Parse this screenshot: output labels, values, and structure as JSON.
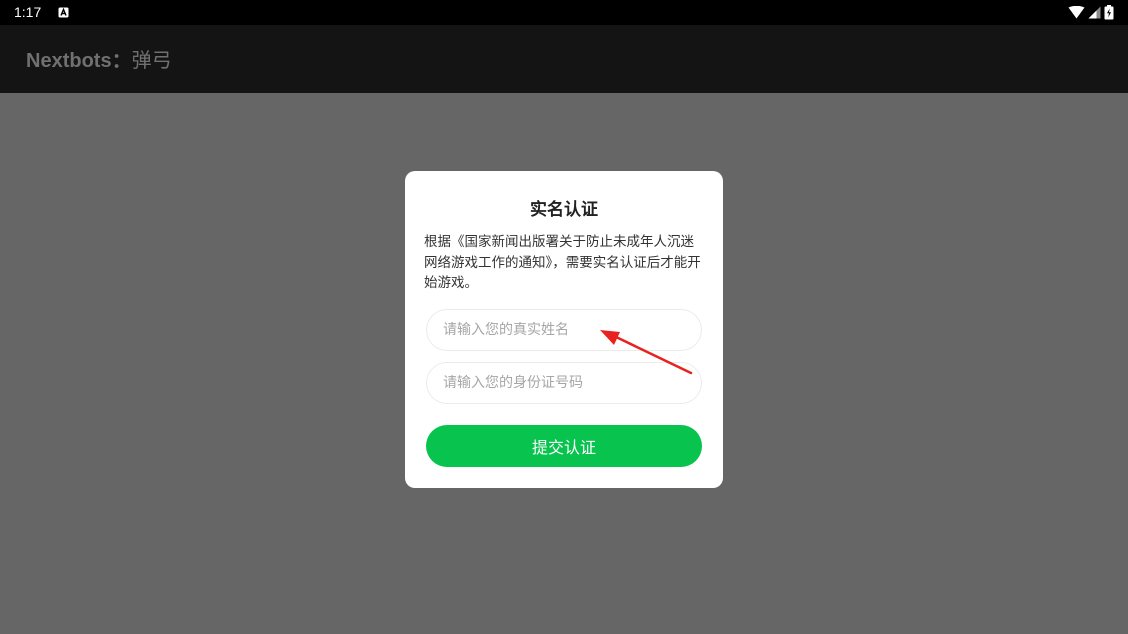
{
  "status_bar": {
    "time": "1:17",
    "app_icon": "android-system-icon",
    "icons": [
      "wifi-icon",
      "cell-signal-icon",
      "battery-charging-icon"
    ]
  },
  "app_bar": {
    "title_prefix": "Nextbots：",
    "title_suffix": "弹弓"
  },
  "dialog": {
    "title": "实名认证",
    "body": "根据《国家新闻出版署关于防止未成年人沉迷网络游戏工作的通知》，需要实名认证后才能开始游戏。",
    "name_input": {
      "placeholder": "请输入您的真实姓名",
      "value": ""
    },
    "id_input": {
      "placeholder": "请输入您的身份证号码",
      "value": ""
    },
    "submit_label": "提交认证"
  },
  "colors": {
    "overlay": "#666666",
    "app_bar": "#141414",
    "submit_button": "#08c44f",
    "annotation_arrow": "#e8231f"
  }
}
